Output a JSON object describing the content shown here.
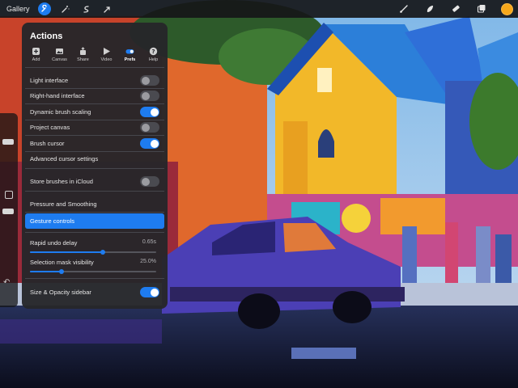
{
  "toolbar": {
    "gallery_label": "Gallery",
    "left_icons": [
      "wrench-icon",
      "magic-wand-icon",
      "selection-icon",
      "transform-arrow-icon"
    ],
    "right_icons": [
      "brush-icon",
      "smudge-icon",
      "eraser-icon",
      "layers-icon"
    ],
    "current_color": "#f7a81b"
  },
  "panel": {
    "title": "Actions",
    "tabs": [
      {
        "label": "Add",
        "icon": "add-icon"
      },
      {
        "label": "Canvas",
        "icon": "canvas-icon"
      },
      {
        "label": "Share",
        "icon": "share-icon"
      },
      {
        "label": "Video",
        "icon": "video-play-icon"
      },
      {
        "label": "Prefs",
        "icon": "prefs-toggle-icon"
      },
      {
        "label": "Help",
        "icon": "help-icon"
      }
    ],
    "active_tab": "Prefs",
    "prefs": {
      "light_interface": {
        "label": "Light interface",
        "on": false
      },
      "right_hand_interface": {
        "label": "Right-hand interface",
        "on": false
      },
      "dynamic_brush_scaling": {
        "label": "Dynamic brush scaling",
        "on": true
      },
      "project_canvas": {
        "label": "Project canvas",
        "on": false
      },
      "brush_cursor": {
        "label": "Brush cursor",
        "on": true
      },
      "advanced_cursor": {
        "label": "Advanced cursor settings"
      },
      "store_brushes": {
        "label": "Store brushes in iCloud",
        "on": false
      },
      "pressure_smoothing": {
        "label": "Pressure and Smoothing"
      },
      "gesture_controls": {
        "label": "Gesture controls"
      },
      "rapid_undo": {
        "label": "Rapid undo delay",
        "value": "0.65s",
        "fraction": 0.58
      },
      "selection_mask": {
        "label": "Selection mask visibility",
        "value": "25.0%",
        "fraction": 0.25
      },
      "size_opacity_sidebar": {
        "label": "Size & Opacity sidebar",
        "on": true
      }
    }
  },
  "colors": {
    "accent": "#1e7cf0",
    "panel_bg": "#26262a"
  }
}
